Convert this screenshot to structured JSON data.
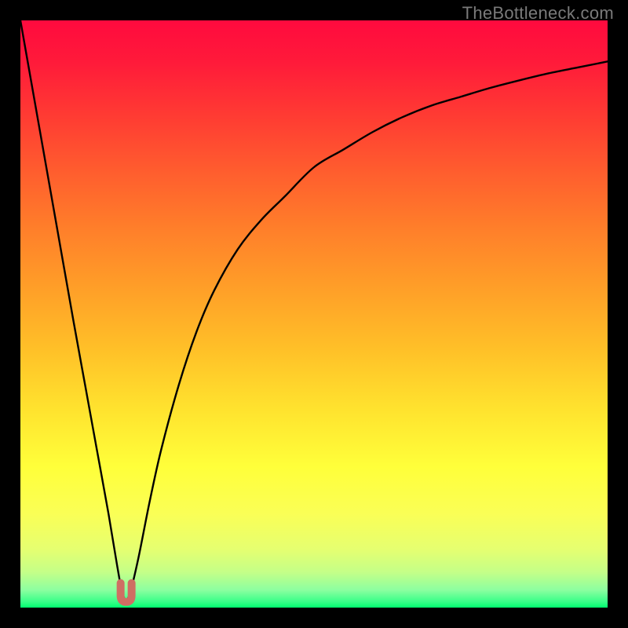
{
  "watermark": "TheBottleneck.com",
  "chart_data": {
    "type": "line",
    "title": "",
    "xlabel": "",
    "ylabel": "",
    "xlim": [
      0,
      100
    ],
    "ylim": [
      0,
      100
    ],
    "notes": "Bottleneck-style curve with vertical gradient background (red→yellow→green). Single black curve dips to ~0 near x≈18 and rises to the right approaching ~93.",
    "series": [
      {
        "name": "bottleneck-curve",
        "color": "#000000",
        "x": [
          0,
          3,
          6,
          9,
          11,
          13,
          15,
          16.5,
          17.5,
          18.5,
          20,
          22,
          24,
          27,
          30,
          33,
          37,
          41,
          45,
          50,
          55,
          60,
          65,
          70,
          75,
          80,
          85,
          90,
          95,
          100
        ],
        "y": [
          100,
          83,
          66,
          49,
          38,
          27,
          16,
          7,
          2,
          2,
          8,
          18,
          27,
          38,
          47,
          54,
          61,
          66,
          70,
          75,
          78,
          81,
          83.5,
          85.5,
          87,
          88.5,
          89.8,
          91,
          92,
          93
        ]
      },
      {
        "name": "minimum-marker",
        "type": "marker",
        "color": "#cf6e63",
        "shape": "u-notch",
        "x": [
          18
        ],
        "y": [
          1.5
        ]
      }
    ]
  }
}
